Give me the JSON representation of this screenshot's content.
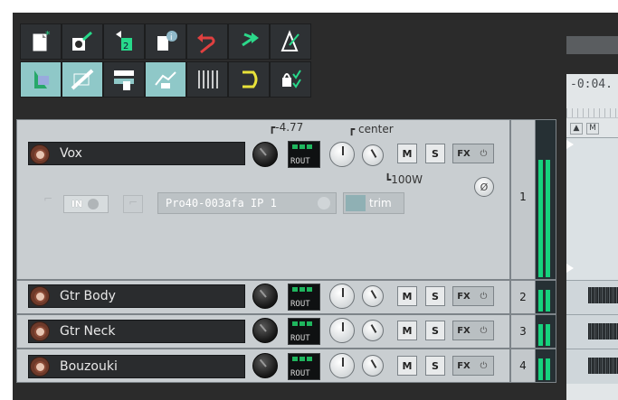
{
  "toolbar": {
    "row1": [
      "new-project-icon",
      "open-project-icon",
      "save-project-icon",
      "project-info-icon",
      "undo-icon",
      "redo-icon",
      "metronome-icon"
    ],
    "row2": [
      "item-snap-icon",
      "ripple-edit-icon",
      "grid-select-icon",
      "envelope-follow-icon",
      "grid-lines-icon",
      "loop-icon",
      "lock-settings-icon"
    ]
  },
  "timeline": {
    "time_label": "-0:04."
  },
  "master_lane": {
    "buttons": [
      "M"
    ]
  },
  "tracks": [
    {
      "number": "1",
      "name": "Vox",
      "volume_db": "-4.77",
      "pan": "center",
      "width": "100W",
      "routing": "ROUT",
      "mute": "M",
      "solo": "S",
      "fx": "FX",
      "power": "⏻",
      "input_label": "IN",
      "fx_chain_label": "Pro40-003afa IP 1",
      "trim_label": "trim",
      "phase": "Ø"
    },
    {
      "number": "2",
      "name": "Gtr Body",
      "routing": "ROUT",
      "mute": "M",
      "solo": "S",
      "fx": "FX",
      "power": "⏻"
    },
    {
      "number": "3",
      "name": "Gtr Neck",
      "routing": "ROUT",
      "mute": "M",
      "solo": "S",
      "fx": "FX",
      "power": "⏻"
    },
    {
      "number": "4",
      "name": "Bouzouki",
      "routing": "ROUT",
      "mute": "M",
      "solo": "S",
      "fx": "FX",
      "power": "⏻"
    }
  ],
  "colors": {
    "meter_green": "#16d27d",
    "record_red": "#6e3a2a",
    "toolbar_active": "#8fc8c8"
  }
}
